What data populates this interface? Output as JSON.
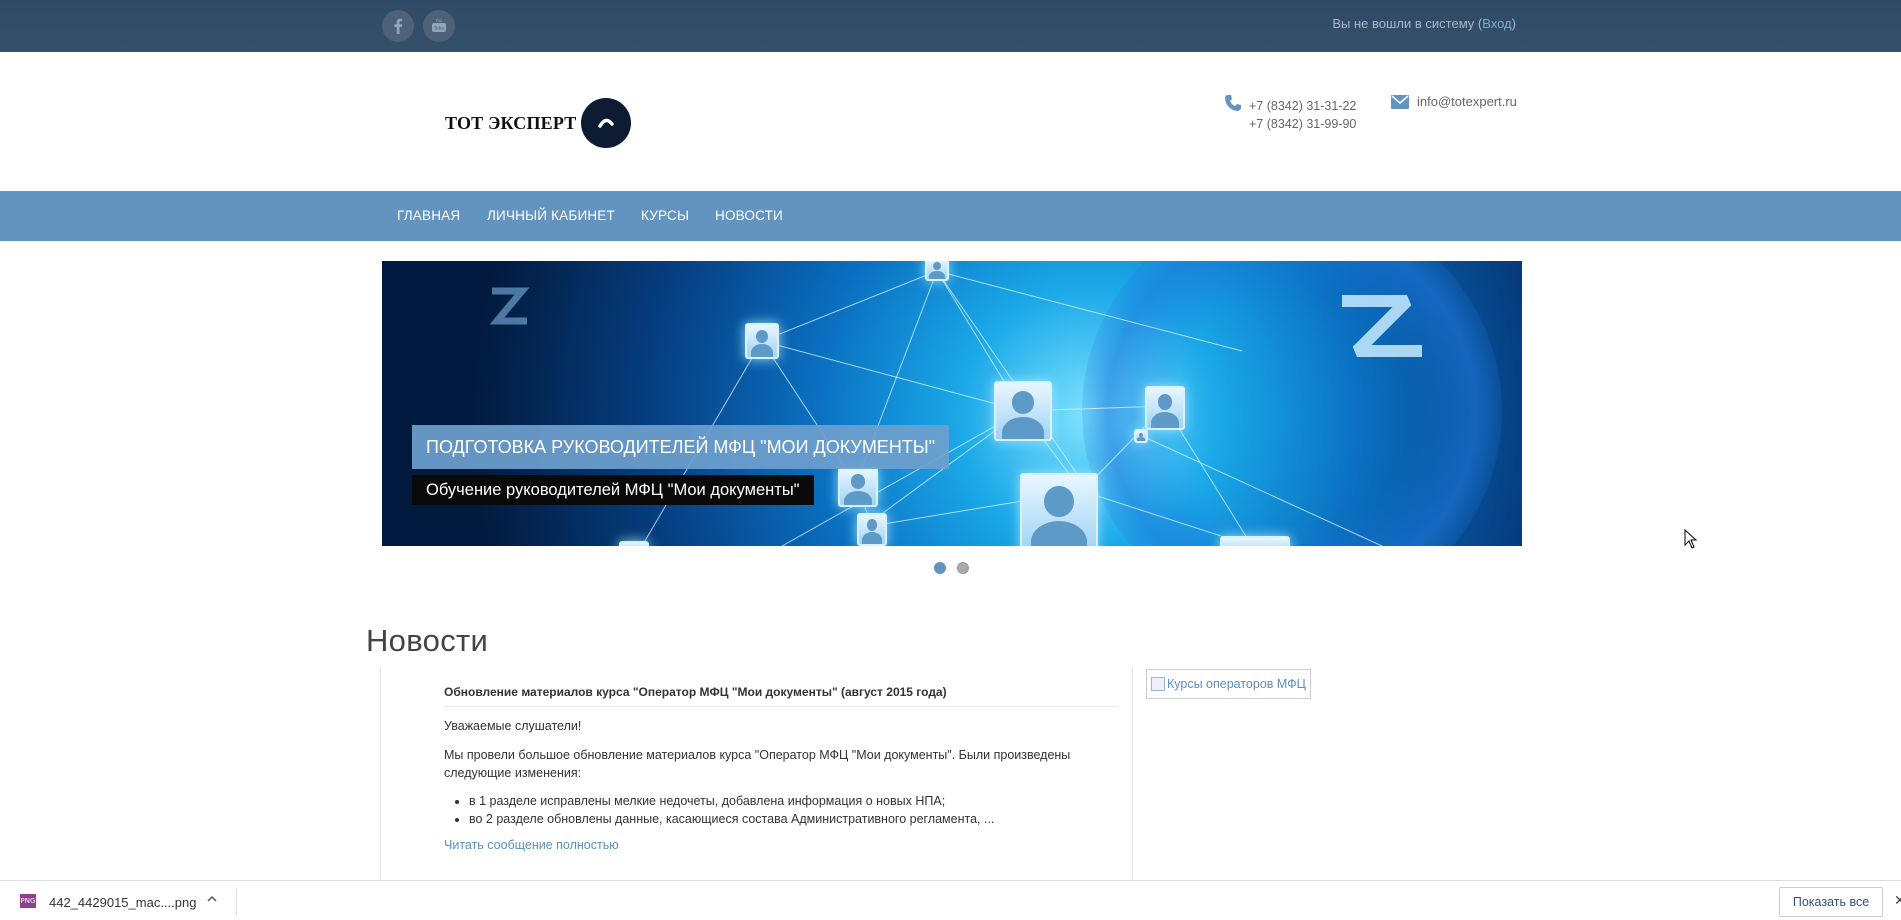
{
  "topbar": {
    "social": [
      {
        "name": "facebook-icon",
        "glyph": "f"
      },
      {
        "name": "youtube-icon",
        "glyph": "You"
      }
    ],
    "login_prefix": "Вы не вошли в систему (",
    "login_link": "Вход",
    "login_suffix": ")"
  },
  "header": {
    "logo_text": "ТОТ ЭКСПЕРТ",
    "phones": [
      "+7 (8342) 31-31-22",
      "+7 (8342) 31-99-90"
    ],
    "email": "info@totexpert.ru"
  },
  "nav": {
    "items": [
      "ГЛАВНАЯ",
      "ЛИЧНЫЙ КАБИНЕТ",
      "КУРСЫ",
      "НОВОСТИ"
    ]
  },
  "slider": {
    "caption_title": "ПОДГОТОВКА РУКОВОДИТЕЛЕЙ МФЦ \"МОИ ДОКУМЕНТЫ\"",
    "caption_subtitle": "Обучение руководителей МФЦ \"Мои документы\"",
    "slide_count": 2,
    "active_slide": 1
  },
  "news": {
    "heading": "Новости",
    "article": {
      "title": "Обновление материалов курса \"Оператор МФЦ \"Мои документы\" (август 2015 года)",
      "greeting": "Уважаемые слушатели!",
      "body": "Мы провели большое обновление материалов курса \"Оператор МФЦ \"Мои документы\". Были произведены следующие изменения:",
      "bullets": [
        "в 1 разделе исправлены мелкие недочеты, добавлена информация о новых НПА;",
        "во 2 разделе обновлены данные, касающиеся состава Административного регламента, ..."
      ],
      "read_more": "Читать сообщение полностью"
    },
    "side_image_alt": "Курсы операторов МФЦ"
  },
  "download_bar": {
    "file_name": "442_4429015_mac....png",
    "file_type": "PNG",
    "show_all": "Показать все",
    "close": "✕"
  },
  "colors": {
    "topbar": "#34495e",
    "nav": "#6394bf",
    "link": "#5b8fbf"
  }
}
